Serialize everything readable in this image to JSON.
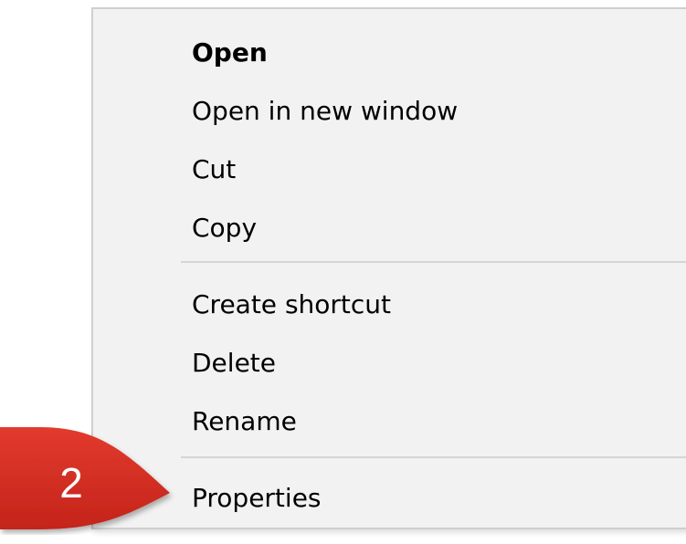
{
  "context_menu": {
    "items": [
      {
        "label": "Open",
        "bold": true
      },
      {
        "label": "Open in new window"
      },
      {
        "label": "Cut"
      },
      {
        "label": "Copy"
      },
      {
        "label": "Create shortcut"
      },
      {
        "label": "Delete"
      },
      {
        "label": "Rename"
      },
      {
        "label": "Properties"
      }
    ]
  },
  "callout": {
    "number": "2",
    "color": "#d02b20"
  }
}
